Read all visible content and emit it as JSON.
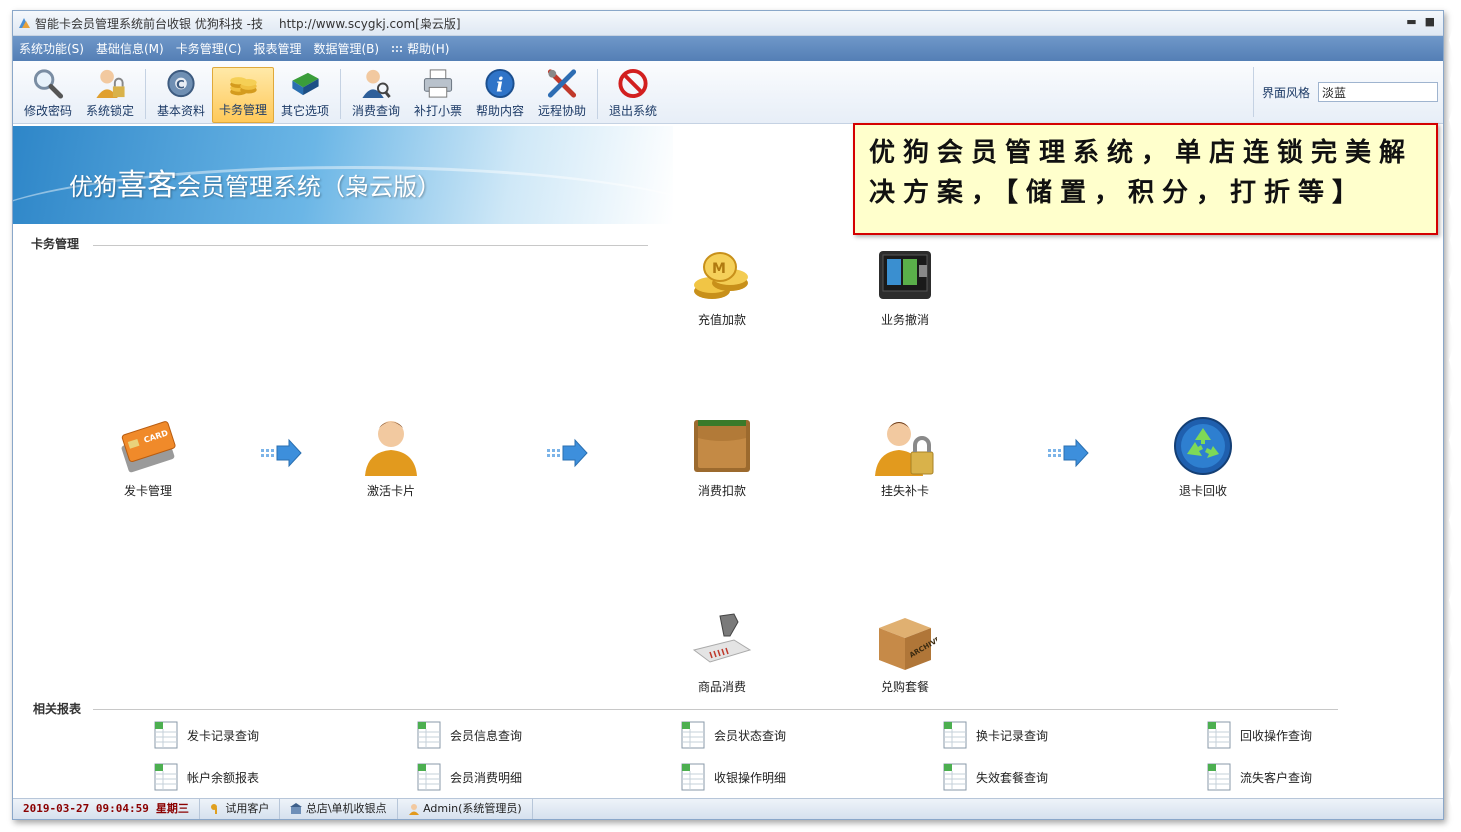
{
  "window": {
    "title": "智能卡会员管理系统前台收银  优狗科技 -技",
    "url": "http://www.scygkj.com[枭云版]",
    "minimize": "▬",
    "maximize": "■"
  },
  "menu": [
    "系统功能(S)",
    "基础信息(M)",
    "卡务管理(C)",
    "报表管理",
    "数据管理(B)",
    "帮助(H)"
  ],
  "toolbar": {
    "items": [
      "修改密码",
      "系统锁定",
      "基本资料",
      "卡务管理",
      "其它选项",
      "消费查询",
      "补打小票",
      "帮助内容",
      "远程协助",
      "退出系统"
    ],
    "active": "卡务管理",
    "style_label": "界面风格",
    "style_value": "淡蓝"
  },
  "banner": {
    "prefix": "优狗",
    "highlight": "喜客",
    "suffix": "会员管理系统（枭云版）"
  },
  "card_section": {
    "title": "卡务管理",
    "features": {
      "recharge": "充值加款",
      "revoke": "业务撤消",
      "issue": "发卡管理",
      "activate": "激活卡片",
      "consume": "消费扣款",
      "lost": "挂失补卡",
      "refund": "退卡回收",
      "goods": "商品消费",
      "package": "兑购套餐"
    }
  },
  "reports": {
    "title": "相关报表",
    "items": [
      "发卡记录查询",
      "会员信息查询",
      "会员状态查询",
      "换卡记录查询",
      "回收操作查询",
      "帐户余额报表",
      "会员消费明细",
      "收银操作明细",
      "失效套餐查询",
      "流失客户查询"
    ]
  },
  "status": {
    "datetime": "2019-03-27 09:04:59",
    "weekday": "星期三",
    "customer": "试用客户",
    "store": "总店\\单机收银点",
    "user": "Admin(系统管理员)"
  },
  "callout": {
    "text": "优狗会员管理系统，单店连锁完美解决方案，【储置，积分，打折等】"
  },
  "colors": {
    "menubar": "#5b86bb",
    "callout_border": "#d40000",
    "callout_bg": "#ffffcc",
    "toolbar_active": "#ffc95a"
  }
}
